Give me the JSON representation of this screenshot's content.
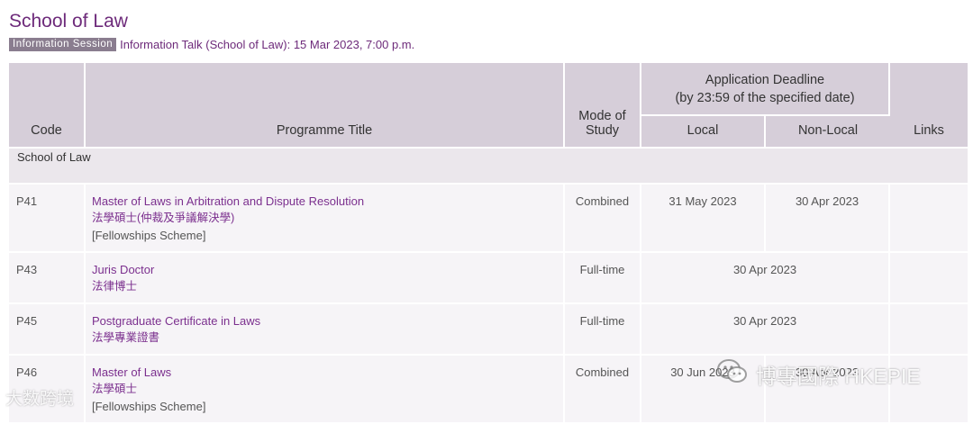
{
  "page": {
    "title": "School of Law",
    "badge": "Information Session",
    "info_text": "Information Talk (School of Law): 15 Mar 2023, 7:00 p.m."
  },
  "table": {
    "headers": {
      "code": "Code",
      "programme_title": "Programme Title",
      "mode_line1": "Mode of",
      "mode_line2": "Study",
      "deadline_line1": "Application Deadline",
      "deadline_line2": "(by 23:59 of the specified date)",
      "local": "Local",
      "non_local": "Non-Local",
      "links": "Links"
    },
    "group": "School of Law",
    "rows": [
      {
        "code": "P41",
        "title_en": "Master of Laws in Arbitration and Dispute Resolution",
        "title_zh": "法學碩士(仲裁及爭議解決學)",
        "note": "[Fellowships Scheme]",
        "mode": "Combined",
        "local": "31 May 2023",
        "non_local": "30 Apr 2023"
      },
      {
        "code": "P43",
        "title_en": "Juris Doctor",
        "title_zh": "法律博士",
        "mode": "Full-time",
        "deadline": "30 Apr 2023"
      },
      {
        "code": "P45",
        "title_en": "Postgraduate Certificate in Laws",
        "title_zh": "法學專業證書",
        "mode": "Full-time",
        "deadline": "30 Apr 2023"
      },
      {
        "code": "P46",
        "title_en": "Master of Laws",
        "title_zh": "法學碩士",
        "note": "[Fellowships Scheme]",
        "mode": "Combined",
        "local": "30 Jun 2023",
        "non_local": "30 Apr 2023"
      }
    ]
  },
  "watermarks": {
    "left": "大数跨境",
    "right": "博專國際 HKEPIE"
  }
}
